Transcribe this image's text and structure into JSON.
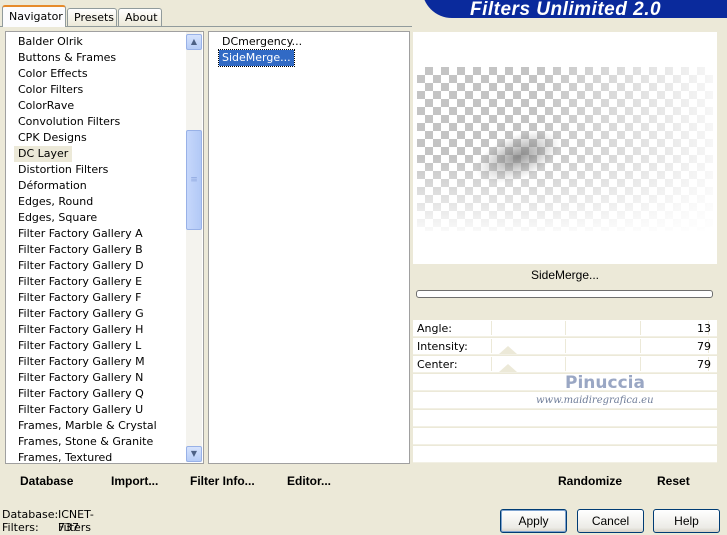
{
  "tabs": [
    "Navigator",
    "Presets",
    "About"
  ],
  "banner_title": "Filters Unlimited 2.0",
  "categories": [
    "Balder Olrik",
    "Buttons & Frames",
    "Color Effects",
    "Color Filters",
    "ColorRave",
    "Convolution Filters",
    "CPK Designs",
    "DC Layer",
    "Distortion Filters",
    "Déformation",
    "Edges, Round",
    "Edges, Square",
    "Filter Factory Gallery A",
    "Filter Factory Gallery B",
    "Filter Factory Gallery D",
    "Filter Factory Gallery E",
    "Filter Factory Gallery F",
    "Filter Factory Gallery G",
    "Filter Factory Gallery H",
    "Filter Factory Gallery L",
    "Filter Factory Gallery M",
    "Filter Factory Gallery N",
    "Filter Factory Gallery Q",
    "Filter Factory Gallery U",
    "Frames, Marble & Crystal",
    "Frames, Stone & Granite",
    "Frames, Textured"
  ],
  "selected_category": "DC Layer",
  "filters": [
    "DCmergency...",
    "SideMerge..."
  ],
  "selected_filter": "SideMerge...",
  "left_buttons": {
    "database": "Database",
    "import": "Import...",
    "filter_info": "Filter Info...",
    "editor": "Editor..."
  },
  "preview": {
    "filter_name": "SideMerge...",
    "progress": 0
  },
  "params": [
    {
      "label": "Angle:",
      "value": "13"
    },
    {
      "label": "Intensity:",
      "value": "79"
    },
    {
      "label": "Center:",
      "value": "79"
    }
  ],
  "watermark": {
    "name": "Pinuccia",
    "url": "www.maidiregrafica.eu"
  },
  "right_buttons": {
    "randomize": "Randomize",
    "reset": "Reset"
  },
  "status": {
    "database_label": "Database:",
    "database_value": "ICNET-Filters",
    "filters_label": "Filters:",
    "filters_value": "737"
  },
  "dialog_buttons": {
    "apply": "Apply",
    "cancel": "Cancel",
    "help": "Help"
  },
  "colors": {
    "banner": "#0a2a9c",
    "selection": "#316ac5",
    "dialog_bg": "#ece9d8"
  }
}
